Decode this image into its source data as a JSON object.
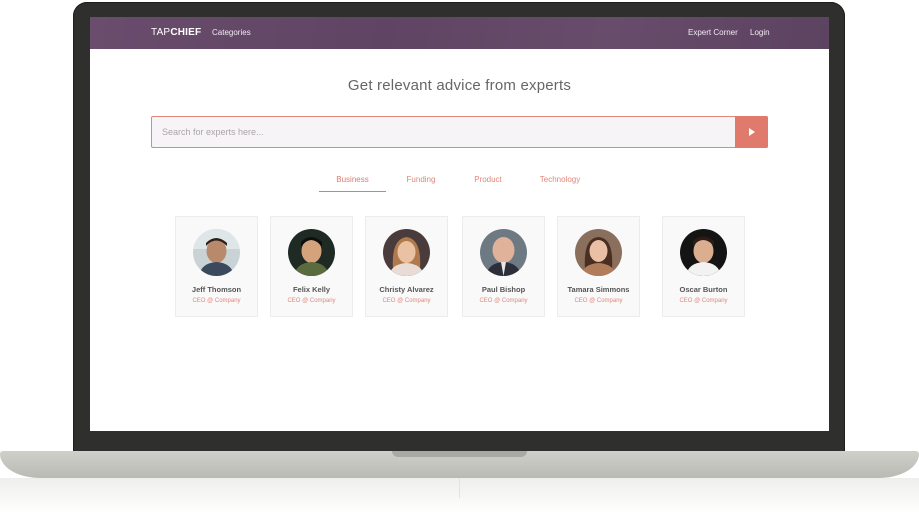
{
  "navbar": {
    "brand_light": "TAP",
    "brand_bold": "CHIEF",
    "categories_label": "Categories",
    "expert_corner_label": "Expert Corner",
    "login_label": "Login"
  },
  "hero": {
    "headline": "Get relevant advice from experts"
  },
  "search": {
    "placeholder": "Search for experts here...",
    "button_icon": "play-icon"
  },
  "tabs": [
    {
      "label": "Business",
      "active": true
    },
    {
      "label": "Funding",
      "active": false
    },
    {
      "label": "Product",
      "active": false
    },
    {
      "label": "Technology",
      "active": false
    }
  ],
  "experts": [
    {
      "name": "Jeff Thomson",
      "role": "CEO @ Company"
    },
    {
      "name": "Felix Kelly",
      "role": "CEO @ Company"
    },
    {
      "name": "Christy Alvarez",
      "role": "CEO @ Company"
    },
    {
      "name": "Paul Bishop",
      "role": "CEO @ Company"
    },
    {
      "name": "Tamara Simmons",
      "role": "CEO @ Company"
    },
    {
      "name": "Oscar Burton",
      "role": "CEO @ Company"
    }
  ],
  "colors": {
    "navbar": "#624764",
    "accent": "#e07a6c",
    "card_bg": "#f9f9fa"
  }
}
